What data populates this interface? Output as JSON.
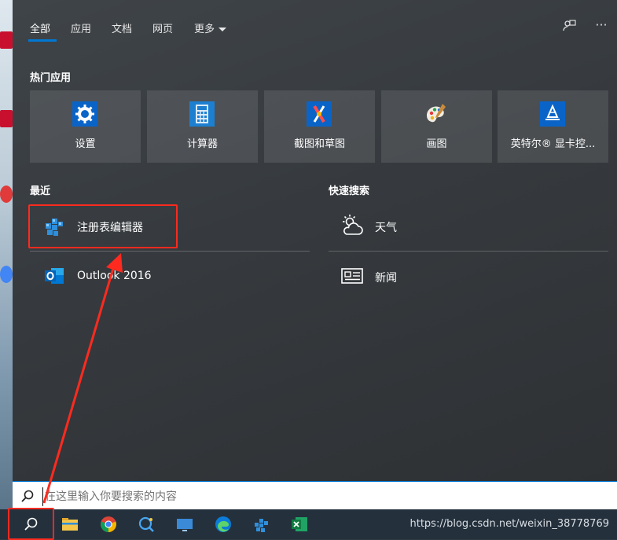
{
  "tabs": [
    {
      "label": "全部"
    },
    {
      "label": "应用"
    },
    {
      "label": "文档"
    },
    {
      "label": "网页"
    },
    {
      "label": "更多"
    }
  ],
  "header_icons": {
    "feedback": "feedback-icon",
    "more": "···"
  },
  "top_apps": {
    "title": "热门应用",
    "items": [
      {
        "label": "设置",
        "icon": "gear-icon"
      },
      {
        "label": "计算器",
        "icon": "calculator-icon"
      },
      {
        "label": "截图和草图",
        "icon": "snip-sketch-icon"
      },
      {
        "label": "画图",
        "icon": "paint-icon"
      },
      {
        "label": "英特尔® 显卡控...",
        "icon": "intel-graphics-icon"
      }
    ]
  },
  "recent": {
    "title": "最近",
    "items": [
      {
        "label": "注册表编辑器",
        "icon": "regedit-icon"
      },
      {
        "label": "Outlook 2016",
        "icon": "outlook-icon"
      }
    ]
  },
  "quick_search": {
    "title": "快速搜索",
    "items": [
      {
        "label": "天气",
        "icon": "weather-icon"
      },
      {
        "label": "新闻",
        "icon": "news-icon"
      }
    ]
  },
  "search": {
    "placeholder": "在这里输入你要搜索的内容"
  },
  "taskbar": {
    "items": [
      "search-icon",
      "file-explorer-icon",
      "chrome-icon",
      "cortana-icon",
      "desktop-icon",
      "edge-icon",
      "regedit-icon",
      "excel-icon"
    ],
    "watermark": "https://blog.csdn.net/weixin_38778769"
  },
  "colors": {
    "accent": "#0078d4",
    "annotation": "#ff2a1f"
  }
}
